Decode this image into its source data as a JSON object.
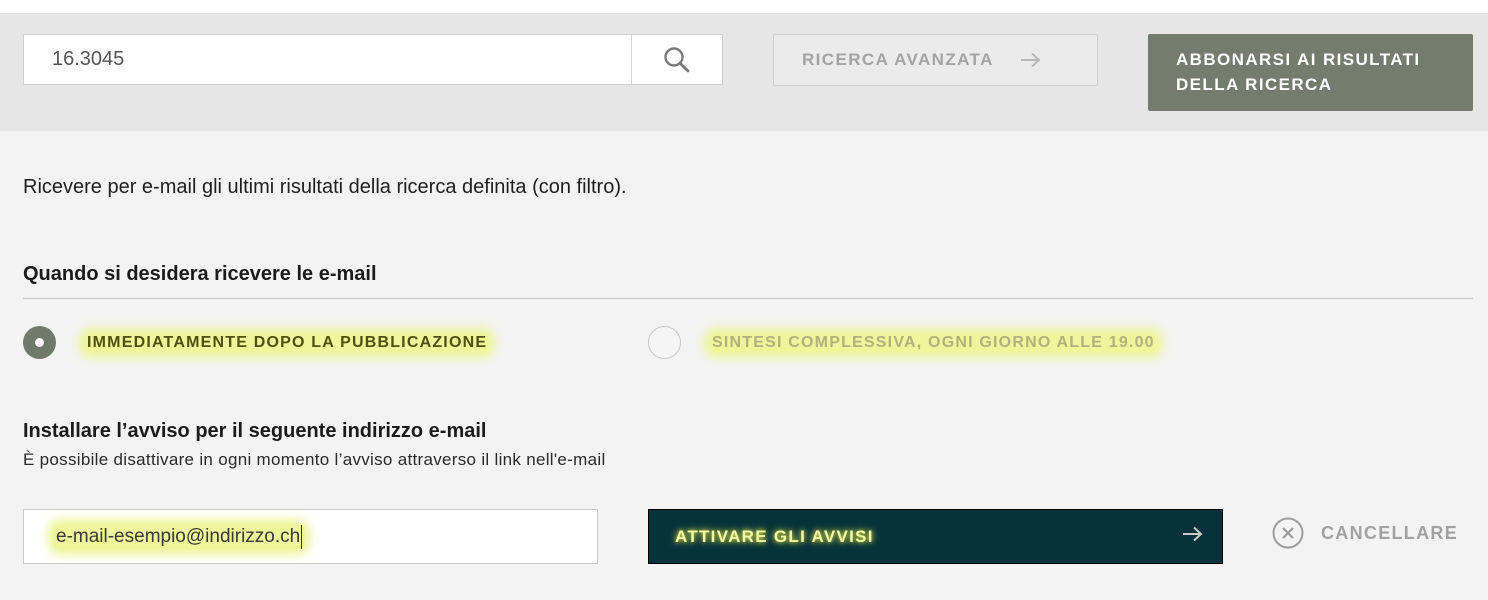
{
  "search": {
    "value": "16.3045"
  },
  "toolbar": {
    "advanced_search_label": "RICERCA AVANZATA",
    "subscribe_label_line1": "ABBONARSI AI RISULTATI",
    "subscribe_label_line2": "DELLA RICERCA"
  },
  "subscription": {
    "intro": "Ricevere per e-mail gli ultimi risultati della ricerca definita (con filtro).",
    "frequency": {
      "title": "Quando si desidera ricevere le e-mail",
      "options": [
        {
          "label": "IMMEDIATAMENTE DOPO LA PUBBLICAZIONE",
          "selected": true
        },
        {
          "label": "SINTESI COMPLESSIVA, OGNI GIORNO ALLE 19.00",
          "selected": false
        }
      ]
    },
    "email_section": {
      "title": "Installare l’avviso per il seguente indirizzo e-mail",
      "subtitle": "È possibile disattivare in ogni momento l’avviso attraverso il link nell'e-mail",
      "email_value": "e-mail-esempio@indirizzo.ch"
    },
    "activate_label": "ATTIVARE GLI AVVISI",
    "cancel_label": "CANCELLARE"
  },
  "colors": {
    "accent_green": "#737c6d",
    "dark_teal": "#07323b",
    "highlight": "#eef59a"
  },
  "icons": {
    "search": "search-icon",
    "arrow": "arrow-right-icon",
    "cancel": "close-circle-icon"
  }
}
